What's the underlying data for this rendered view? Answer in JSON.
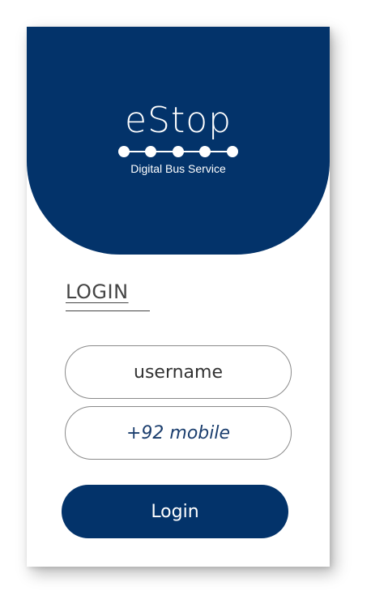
{
  "brand": {
    "name": "eStop",
    "tagline": "Digital Bus Service",
    "primary_color": "#03336a",
    "logo_icon": "bus-stops-dots-icon"
  },
  "login": {
    "title": "LOGIN",
    "username_placeholder": "username",
    "mobile_placeholder": "+92 mobile",
    "button_label": "Login"
  }
}
